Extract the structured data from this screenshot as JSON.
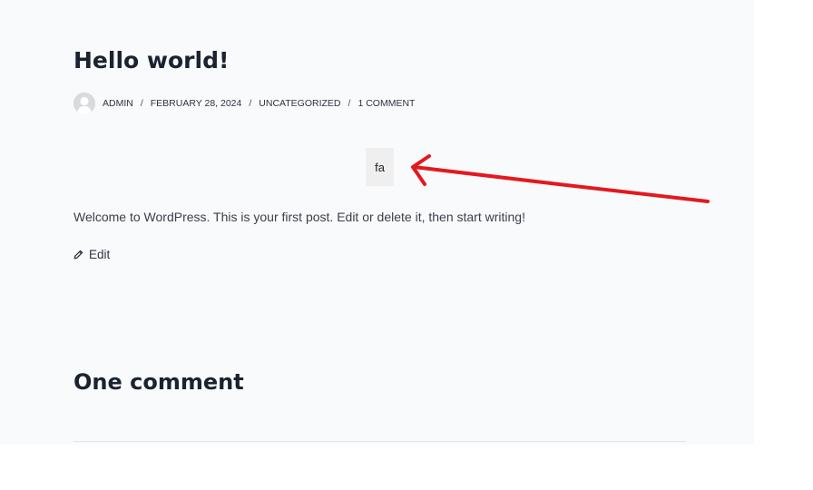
{
  "post": {
    "title": "Hello world!",
    "meta": {
      "author": "ADMIN",
      "date": "FEBRUARY 28, 2024",
      "category": "UNCATEGORIZED",
      "comments": "1 COMMENT",
      "separator": "/"
    },
    "fa_text": "fa",
    "body": "Welcome to WordPress. This is your first post. Edit or delete it, then start writing!",
    "edit_label": "Edit"
  },
  "comments": {
    "title": "One comment"
  },
  "annotation": {
    "arrow_color": "#e3191e"
  },
  "icons": {
    "avatar": "default-avatar-icon",
    "edit": "pencil-icon"
  }
}
